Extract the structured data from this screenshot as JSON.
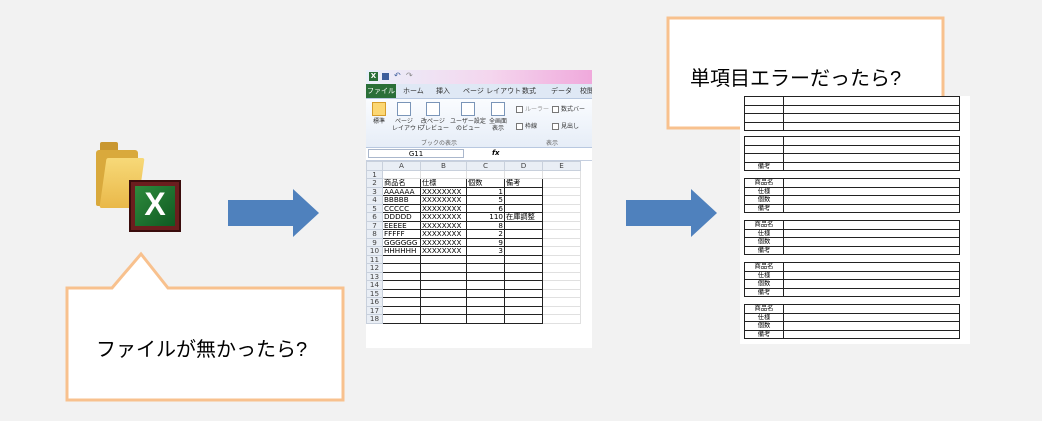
{
  "callouts": {
    "missing_file": "ファイルが無かったら?",
    "single_error": "単項目エラーだったら?"
  },
  "excel": {
    "icon_letter": "X",
    "tabs": [
      "ファイル",
      "ホーム",
      "挿入",
      "ページ レイアウト",
      "数式",
      "データ",
      "校閲"
    ],
    "ribbon_buttons": [
      {
        "line1": "標準",
        "line2": ""
      },
      {
        "line1": "ページ",
        "line2": "レイアウト"
      },
      {
        "line1": "改ページ",
        "line2": "プレビュー"
      },
      {
        "line1": "ユーザー設定",
        "line2": "のビュー"
      },
      {
        "line1": "全画面",
        "line2": "表示"
      }
    ],
    "group_labels": [
      "ブックの表示",
      "表示"
    ],
    "checkboxes": [
      "ルーラー",
      "数式バー",
      "枠線",
      "見出し"
    ],
    "name_box": "G11",
    "fx": "fx",
    "columns": [
      "",
      "A",
      "B",
      "C",
      "D",
      "E"
    ],
    "rows": [
      [
        "1",
        "",
        "",
        "",
        ""
      ],
      [
        "2",
        "商品名",
        "仕様",
        "個数",
        "備考"
      ],
      [
        "3",
        "AAAAAA",
        "XXXXXXXX",
        "1",
        ""
      ],
      [
        "4",
        "BBBBB",
        "XXXXXXXX",
        "5",
        ""
      ],
      [
        "5",
        "CCCCC",
        "XXXXXXXX",
        "6",
        ""
      ],
      [
        "6",
        "DDDDD",
        "XXXXXXXX",
        "110",
        "在庫調整"
      ],
      [
        "7",
        "EEEEE",
        "XXXXXXXX",
        "8",
        ""
      ],
      [
        "8",
        "FFFFF",
        "XXXXXXXX",
        "2",
        ""
      ],
      [
        "9",
        "GGGGGG",
        "XXXXXXXX",
        "9",
        ""
      ],
      [
        "10",
        "HHHHHH",
        "XXXXXXXX",
        "3",
        ""
      ],
      [
        "11",
        "",
        "",
        "",
        ""
      ],
      [
        "12",
        "",
        "",
        "",
        ""
      ],
      [
        "13",
        "",
        "",
        "",
        ""
      ],
      [
        "14",
        "",
        "",
        "",
        ""
      ],
      [
        "15",
        "",
        "",
        "",
        ""
      ],
      [
        "16",
        "",
        "",
        "",
        ""
      ],
      [
        "17",
        "",
        "",
        "",
        ""
      ],
      [
        "18",
        "",
        "",
        "",
        ""
      ]
    ]
  },
  "form": {
    "labels": [
      "商品名",
      "仕様",
      "個数",
      "備考"
    ],
    "partial_label": "備考"
  },
  "colors": {
    "arrow": "#4f81bd",
    "callout_border": "#f8c18e",
    "excel_file_tab": "#2a6f38"
  }
}
